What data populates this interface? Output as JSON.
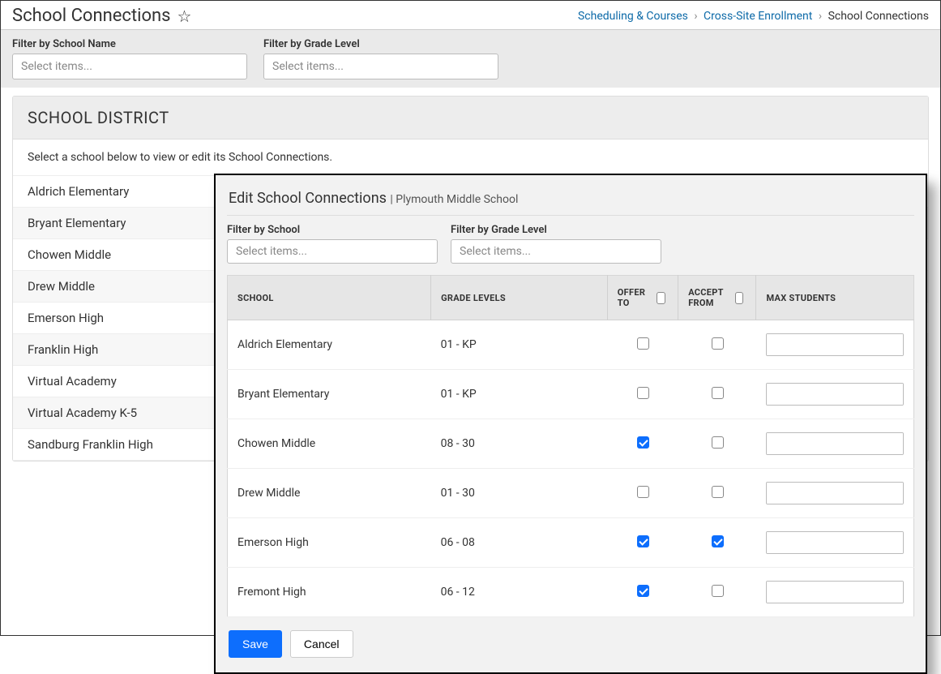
{
  "header": {
    "page_title": "School Connections"
  },
  "breadcrumb": {
    "item1": "Scheduling & Courses",
    "item2": "Cross-Site Enrollment",
    "current": "School Connections"
  },
  "filters": {
    "school_name_label": "Filter by School Name",
    "grade_level_label": "Filter by Grade Level",
    "placeholder": "Select items..."
  },
  "district": {
    "title": "SCHOOL DISTRICT",
    "hint": "Select a school below to view or edit its School Connections.",
    "schools": [
      "Aldrich Elementary",
      "Bryant Elementary",
      "Chowen Middle",
      "Drew Middle",
      "Emerson High",
      "Franklin High",
      "Virtual Academy",
      "Virtual Academy K-5",
      "Sandburg Franklin High"
    ]
  },
  "modal": {
    "title": "Edit School Connections",
    "subtitle_prefix": "| ",
    "subtitle": "Plymouth Middle School",
    "filters": {
      "school_label": "Filter by School",
      "grade_label": "Filter by Grade Level",
      "placeholder": "Select items..."
    },
    "columns": {
      "school": "SCHOOL",
      "grade": "GRADE LEVELS",
      "offer": "OFFER TO",
      "accept": "ACCEPT FROM",
      "max": "MAX STUDENTS"
    },
    "rows": [
      {
        "school": "Aldrich Elementary",
        "grade": "01 - KP",
        "offer": false,
        "accept": false,
        "active_stepper": false
      },
      {
        "school": "Bryant Elementary",
        "grade": "01 - KP",
        "offer": false,
        "accept": false,
        "active_stepper": false
      },
      {
        "school": "Chowen Middle",
        "grade": "08 - 30",
        "offer": true,
        "accept": false,
        "active_stepper": true
      },
      {
        "school": "Drew Middle",
        "grade": "01 - 30",
        "offer": false,
        "accept": false,
        "active_stepper": false
      },
      {
        "school": "Emerson High",
        "grade": "06 - 08",
        "offer": true,
        "accept": true,
        "active_stepper": true
      },
      {
        "school": "Fremont High",
        "grade": "06 - 12",
        "offer": true,
        "accept": false,
        "active_stepper": true
      }
    ],
    "actions": {
      "save": "Save",
      "cancel": "Cancel"
    }
  }
}
